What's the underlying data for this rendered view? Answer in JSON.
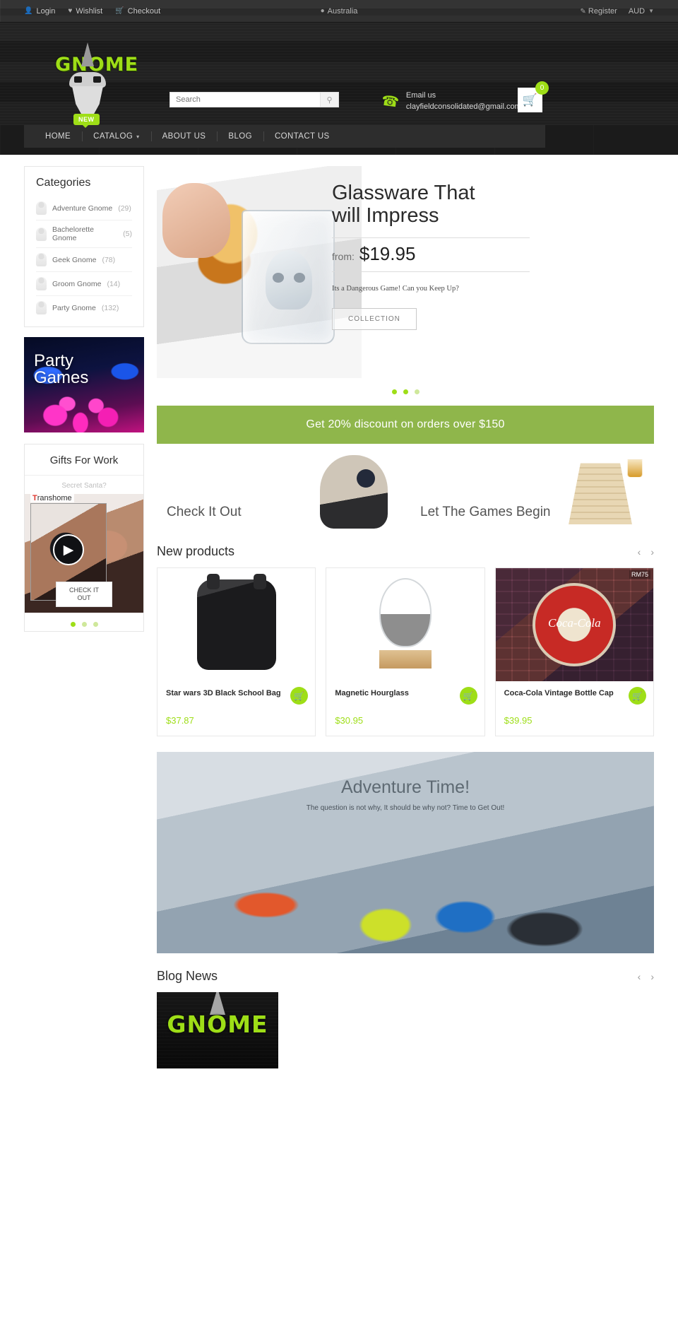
{
  "topbar": {
    "login": "Login",
    "wishlist": "Wishlist",
    "checkout": "Checkout",
    "location": "Australia",
    "register": "Register",
    "currency": "AUD"
  },
  "header": {
    "logo_text": "GNOME",
    "search_placeholder": "Search",
    "email_label": "Email us",
    "email_address": "clayfieldconsolidated@gmail.com",
    "cart_count": "0"
  },
  "nav": {
    "badge": "NEW",
    "items": [
      {
        "label": "HOME"
      },
      {
        "label": "CATALOG"
      },
      {
        "label": "ABOUT US"
      },
      {
        "label": "BLOG"
      },
      {
        "label": "CONTACT US"
      }
    ]
  },
  "sidebar": {
    "categories_title": "Categories",
    "categories": [
      {
        "name": "Adventure Gnome",
        "count": "(29)"
      },
      {
        "name": "Bachelorette Gnome",
        "count": "(5)"
      },
      {
        "name": "Geek Gnome",
        "count": "(78)"
      },
      {
        "name": "Groom Gnome",
        "count": "(14)"
      },
      {
        "name": "Party Gnome",
        "count": "(132)"
      }
    ],
    "party_tile": {
      "line1": "Party",
      "line2": "Games"
    },
    "gifts": {
      "title": "Gifts For Work",
      "subtitle": "Secret Santa?",
      "watermark_first": "T",
      "watermark_rest": "ranshome",
      "cta_line1": "CHECK IT",
      "cta_line2": "OUT",
      "play_icon": "play-icon"
    }
  },
  "hero": {
    "title_line1": "Glassware That",
    "title_line2": "will Impress",
    "from_label": "from:",
    "price": "$19.95",
    "tagline": "Its a Dangerous Game! Can you Keep Up?",
    "button": "COLLECTION"
  },
  "discount": {
    "text": "Get 20% discount on orders over $150"
  },
  "features": [
    {
      "label": "Check It Out"
    },
    {
      "label": "Let The Games Begin"
    }
  ],
  "new_products": {
    "title": "New products",
    "prev_icon": "chevron-left-icon",
    "next_icon": "chevron-right-icon",
    "items": [
      {
        "name": "Star wars 3D Black School Bag",
        "price": "$37.87",
        "tag": ""
      },
      {
        "name": "Magnetic Hourglass",
        "price": "$30.95",
        "tag": ""
      },
      {
        "name": "Coca-Cola Vintage Bottle Cap",
        "price": "$39.95",
        "tag": "RM75",
        "cap_text": "Coca-Cola"
      }
    ]
  },
  "adventure": {
    "title": "Adventure Time!",
    "subtitle": "The question is not why, It should be why not? Time to Get Out!"
  },
  "blog": {
    "title": "Blog News",
    "prev_icon": "chevron-left-icon",
    "next_icon": "chevron-right-icon",
    "card_logo": "GNOME"
  },
  "colors": {
    "accent_green": "#9ede17",
    "banner_green": "#8fb64b",
    "dark": "#1b1b1b"
  }
}
